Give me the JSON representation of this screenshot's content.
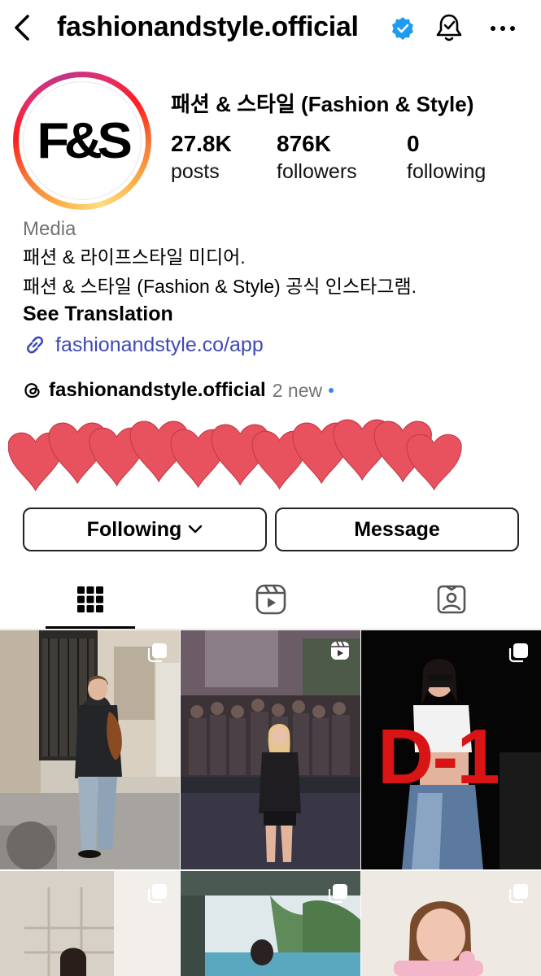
{
  "header": {
    "username": "fashionandstyle.official"
  },
  "profile": {
    "avatar_text": "F&S",
    "display_name": "패션 & 스타일 (Fashion & Style)",
    "stats": [
      {
        "value": "27.8K",
        "label": "posts"
      },
      {
        "value": "876K",
        "label": "followers"
      },
      {
        "value": "0",
        "label": "following"
      }
    ],
    "category": "Media",
    "bio_line1": "패션 & 라이프스타일 미디어.",
    "bio_line2": "패션 & 스타일 (Fashion & Style) 공식 인스타그램.",
    "see_translation": "See Translation",
    "link": "fashionandstyle.co/app",
    "threads_name": "fashionandstyle.official",
    "threads_new": "2 new"
  },
  "actions": {
    "following_label": "Following",
    "message_label": "Message"
  },
  "tabs": [
    {
      "name": "posts-grid-icon",
      "active": true
    },
    {
      "name": "reels-icon",
      "active": false
    },
    {
      "name": "tagged-icon",
      "active": false
    }
  ],
  "grid": [
    {
      "badge": "carousel-icon",
      "overlay_text": ""
    },
    {
      "badge": "reels-icon",
      "overlay_text": ""
    },
    {
      "badge": "carousel-icon",
      "overlay_text": "D-1"
    },
    {
      "badge": "carousel-icon",
      "overlay_text": ""
    },
    {
      "badge": "carousel-icon",
      "overlay_text": ""
    },
    {
      "badge": "carousel-icon",
      "overlay_text": ""
    }
  ],
  "colors": {
    "link": "#3e4ab5",
    "verified": "#1d9bf0",
    "hearts": "#e8525f",
    "secondary_text": "#737373"
  }
}
